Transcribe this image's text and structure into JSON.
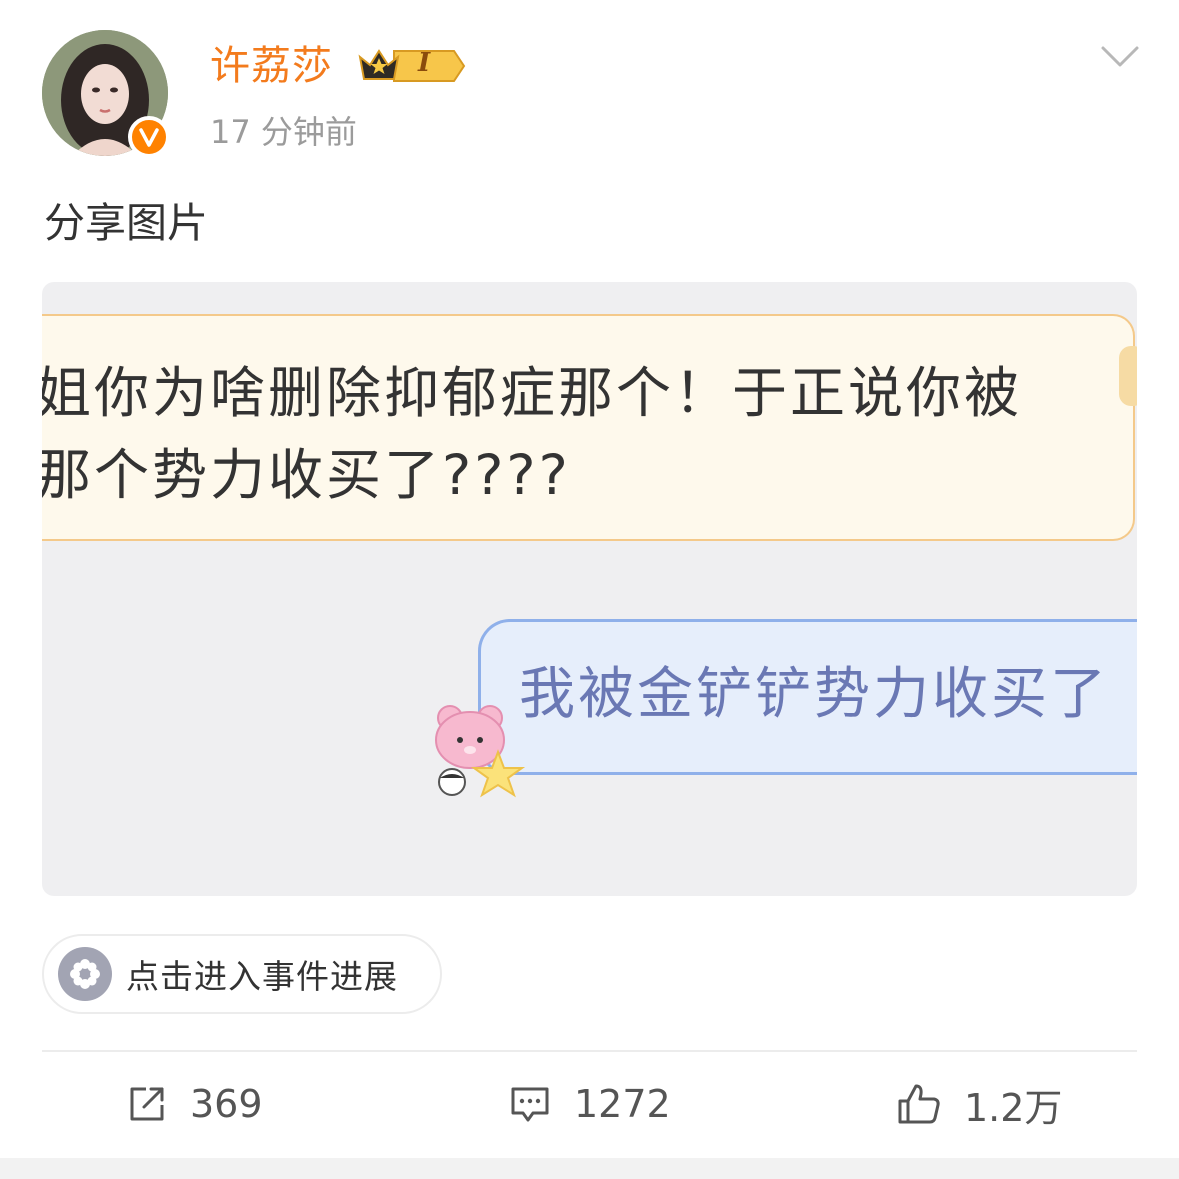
{
  "post": {
    "username": "许荔莎",
    "level_badge": "I",
    "timestamp": "17 分钟前",
    "text": "分享图片"
  },
  "image": {
    "bubble_in_text": "姐你为啥删除抑郁症那个！于正说你被\n那个势力收买了????",
    "bubble_out_text": "我被金铲铲势力收买了"
  },
  "event": {
    "label": "点击进入事件进展"
  },
  "actions": {
    "repost_count": "369",
    "comment_count": "1272",
    "like_count": "1.2万"
  },
  "icons": {
    "avatar": "avatar-photo",
    "verified": "verified-v-icon",
    "level": "crown-level-icon",
    "dropdown": "chevron-down-icon",
    "event": "event-flower-icon",
    "repost": "repost-icon",
    "comment": "comment-icon",
    "like": "thumbs-up-icon"
  },
  "colors": {
    "username": "#f37b1d",
    "verified": "#ff8200",
    "timestamp": "#9b9b9b",
    "bubble_in_bg": "#fef9ec",
    "bubble_out_bg": "#e6eefb",
    "bubble_out_text": "#6a78b4"
  }
}
